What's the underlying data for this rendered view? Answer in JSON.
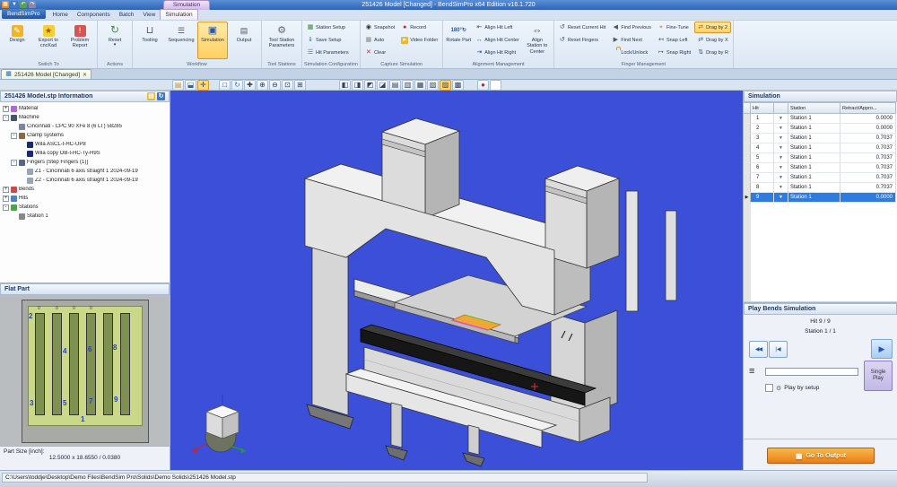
{
  "window": {
    "title": "251426 Model [Changed] - BendSimPro x64 Edition v16.1.720",
    "contextual_group": "Simulation"
  },
  "tabs": {
    "app": "BendSimPro",
    "items": [
      "Home",
      "Components",
      "Batch",
      "View"
    ],
    "active": "Simulation"
  },
  "ribbon": {
    "switch_to": {
      "label": "Switch To",
      "design": "Design",
      "export_cnckad": "Export to cncKad",
      "problem_report": "Problem Report"
    },
    "actions": {
      "label": "Actions",
      "reset": "Reset"
    },
    "workflow": {
      "label": "Workflow",
      "tooling": "Tooling",
      "sequencing": "Sequencing",
      "simulation": "Simulation",
      "output": "Output"
    },
    "tool_stations": {
      "label": "Tool Stations",
      "tool_station_parameters": "Tool Station Parameters"
    },
    "sim_config": {
      "label": "Simulation Configuration",
      "station_setup": "Station Setup",
      "save_setup": "Save Setup",
      "hit_parameters": "Hit Parameters"
    },
    "capture": {
      "label": "Capture Simulation",
      "snapshot": "Snapshot",
      "auto": "Auto",
      "clear": "Clear",
      "record": "Record",
      "video_folder": "Video Folder"
    },
    "alignment": {
      "label": "Alignment Management",
      "rotate_part": "Rotate Part",
      "rotate_icon": "180°",
      "align_hit_left": "Align Hit Left",
      "align_hit_center": "Align Hit Center",
      "align_hit_right": "Align Hit Right",
      "align_station_to_center": "Align Station to Center"
    },
    "finger": {
      "label": "Finger Management",
      "reset_current_hit": "Reset Current Hit",
      "reset_fingers": "Reset Fingers",
      "find_previous": "Find Previous",
      "find_next": "Find Next",
      "lock_unlock": "Lock/Unlock",
      "fine_tune": "Fine-Tune",
      "snap_left": "Snap Left",
      "snap_right": "Snap Right",
      "drag_by_2": "Drag by 2",
      "drag_by_x": "Drag by X",
      "drag_by_r": "Drag by R"
    }
  },
  "doc_tab": {
    "label": "251426 Model [Changed]"
  },
  "tree": {
    "title": "251426 Model.stp Information",
    "nodes": [
      {
        "label": "Material",
        "exp": "+"
      },
      {
        "label": "Machine",
        "exp": "-"
      },
      {
        "label": "Cincinnati - CPC 90 XFe 8 (6 LT) 58285"
      },
      {
        "label": "Clamp systems",
        "exp": "-"
      },
      {
        "label": "Wila ASCL-I-HC-UP8"
      },
      {
        "label": "Wila copy OB-I-HC-Ty-H9S"
      },
      {
        "label": "Fingers [Step Fingers (1)]",
        "exp": "-"
      },
      {
        "label": "Z1 - Cincinnati 6 axis straight 1 2024-09-19"
      },
      {
        "label": "Z2 - Cincinnati 6 axis straight 1 2024-09-19"
      },
      {
        "label": "Bends",
        "exp": "+"
      },
      {
        "label": "Hits",
        "exp": "+"
      },
      {
        "label": "Stations",
        "exp": "-"
      },
      {
        "label": "Station 1"
      }
    ]
  },
  "flat_part": {
    "title": "Flat Part",
    "zeros": [
      "0",
      "0",
      "0",
      "0"
    ],
    "n1": "1",
    "n2": "2",
    "n3": "3",
    "n4": "4",
    "n5": "5",
    "n6": "6",
    "n7": "7",
    "n8": "8",
    "n9": "9",
    "size_label": "Part Size [inch]:",
    "size_value": "12.5000 x 18.6550 / 0.0380"
  },
  "sim_table": {
    "title": "Simulation",
    "col_hit": "Hit",
    "col_station": "Station",
    "col_retract": "Retract/Appro...",
    "rows": [
      {
        "hit": "1",
        "station": "Station 1",
        "value": "0.0000"
      },
      {
        "hit": "2",
        "station": "Station 1",
        "value": "0.0000"
      },
      {
        "hit": "3",
        "station": "Station 1",
        "value": "0.7037"
      },
      {
        "hit": "4",
        "station": "Station 1",
        "value": "0.7037"
      },
      {
        "hit": "5",
        "station": "Station 1",
        "value": "0.7037"
      },
      {
        "hit": "6",
        "station": "Station 1",
        "value": "0.7037"
      },
      {
        "hit": "7",
        "station": "Station 1",
        "value": "0.7037"
      },
      {
        "hit": "8",
        "station": "Station 1",
        "value": "0.7037"
      },
      {
        "hit": "9",
        "station": "Station 1",
        "value": "0.0000"
      }
    ]
  },
  "play": {
    "title": "Play Bends Simulation",
    "hit": "Hit 9 / 9",
    "station": "Station 1 / 1",
    "checkbox": "Play by setup",
    "single": "Single Play"
  },
  "output_btn": {
    "label": "Go To Output"
  },
  "status_bar": {
    "path": "C:\\Users\\toddje\\Desktop\\Demo Files\\BendSim Pro\\Solids\\Demo Solids\\251426 Model.stp"
  }
}
